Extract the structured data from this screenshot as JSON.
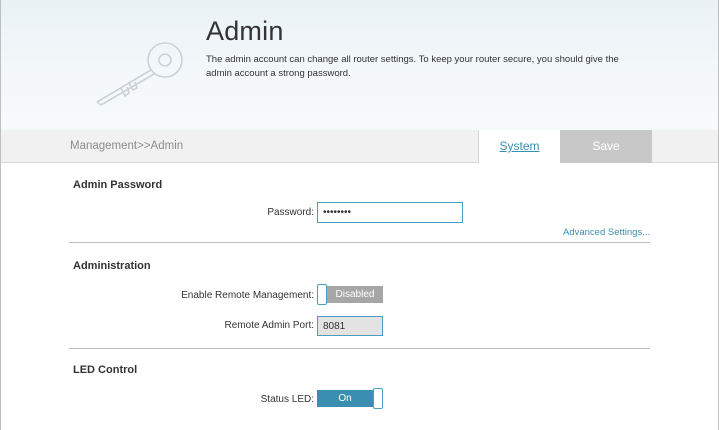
{
  "header": {
    "title": "Admin",
    "description": "The admin account can change all router settings. To keep your router secure, you should give the admin account a strong password."
  },
  "breadcrumb": "Management>>Admin",
  "nav": {
    "system_label": "System",
    "save_label": "Save"
  },
  "admin_password": {
    "section_title": "Admin Password",
    "password_label": "Password:",
    "password_value": "••••••••",
    "advanced_link": "Advanced Settings..."
  },
  "administration": {
    "section_title": "Administration",
    "remote_mgmt_label": "Enable Remote Management:",
    "remote_mgmt_state": "Disabled",
    "remote_port_label": "Remote Admin Port:",
    "remote_port_value": "8081"
  },
  "led_control": {
    "section_title": "LED Control",
    "status_led_label": "Status LED:",
    "status_led_state": "On"
  },
  "colors": {
    "accent": "#3a8fb0",
    "toggle_on": "#3a8fb0",
    "toggle_off": "#a6a6a6",
    "save_disabled": "#c8c8c8"
  },
  "icons": {
    "header_illustration": "key-icon"
  }
}
